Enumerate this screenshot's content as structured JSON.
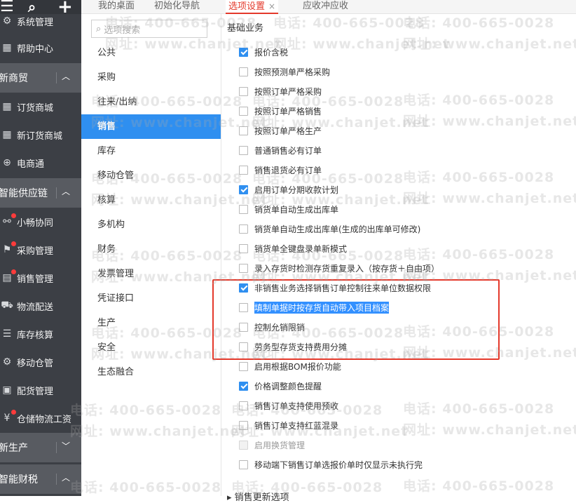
{
  "topbar": {
    "menu_icon": "☰",
    "search_icon": "⌕",
    "add_icon": "+"
  },
  "nav": {
    "partial_top": "系统管理",
    "help": "帮助中心",
    "groups": {
      "new_commerce": "新商贸",
      "supply_chain": "智能供应链",
      "new_production": "新生产",
      "finance": "智能财税"
    },
    "items": {
      "order_mall": "订货商城",
      "new_order_mall": "新订货商城",
      "ecommerce": "电商通",
      "xiaochang": "小畅协同",
      "purchase": "采购管理",
      "sales": "销售管理",
      "logistics": "物流配送",
      "inventory": "库存核算",
      "mobile_warehouse": "移动仓管",
      "distribution": "配货管理",
      "wage": "仓储物流工资"
    }
  },
  "tabs": [
    {
      "label": "我的桌面"
    },
    {
      "label": "初始化导航"
    },
    {
      "label": "选项设置",
      "close": "×"
    },
    {
      "label": "应收冲应收"
    }
  ],
  "search": {
    "placeholder": "选项搜索",
    "icon": "search-icon"
  },
  "categories": [
    "公共",
    "采购",
    "往来/出纳",
    "销售",
    "库存",
    "移动仓管",
    "核算",
    "多机构",
    "财务",
    "发票管理",
    "凭证接口",
    "生产",
    "安全",
    "生态融合"
  ],
  "active_category": "销售",
  "content": {
    "section_title": "基础业务",
    "bottom_stub": "▸ 销售更新选项",
    "options": [
      {
        "label": "报价含税",
        "checked": true
      },
      {
        "label": "按照预测单严格采购",
        "checked": false
      },
      {
        "label": "按照订单严格采购",
        "checked": false
      },
      {
        "label": "按照订单严格销售",
        "checked": false
      },
      {
        "label": "按照订单严格生产",
        "checked": false
      },
      {
        "label": "普通销售必有订单",
        "checked": false
      },
      {
        "label": "销售退货必有订单",
        "checked": false
      },
      {
        "label": "启用订单分期收款计划",
        "checked": true
      },
      {
        "label": "销货单自动生成出库单",
        "checked": false
      },
      {
        "label": "销货单自动生成出库单(生成的出库单可修改)",
        "checked": false
      },
      {
        "label": "销货单全键盘录单新模式",
        "checked": false
      },
      {
        "label": "录入存货时检测存货重复录入（按存货＋自由项）",
        "checked": false
      },
      {
        "label": "非销售业务选择销售订单控制往来单位数据权限",
        "checked": true
      },
      {
        "label": "填制单据时按存货自动带入项目档案",
        "checked": false,
        "highlighted": true
      },
      {
        "label": "控制允销限销",
        "checked": false
      },
      {
        "label": "劳务型存货支持费用分摊",
        "checked": false
      },
      {
        "label": "启用根据BOM报价功能",
        "checked": false
      },
      {
        "label": "价格调整颜色提醒",
        "checked": true
      },
      {
        "label": "销售订单支持使用预收",
        "checked": false
      },
      {
        "label": "销售订单支持红蓝混录",
        "checked": false
      },
      {
        "label": "启用换货管理",
        "checked": false,
        "disabled": true
      },
      {
        "label": "移动端下销售订单选报价单时仅显示未执行完",
        "checked": false
      }
    ]
  },
  "watermark": {
    "phone": "电话: 400-665-0028",
    "url": "网址: www.chanjet.net"
  },
  "colors": {
    "accent": "#2f8ff0",
    "tab_active": "#e4392b",
    "nav_bg": "#3c3f45",
    "badge": "#ff3b3b",
    "annotation_box": "#e4392b"
  }
}
